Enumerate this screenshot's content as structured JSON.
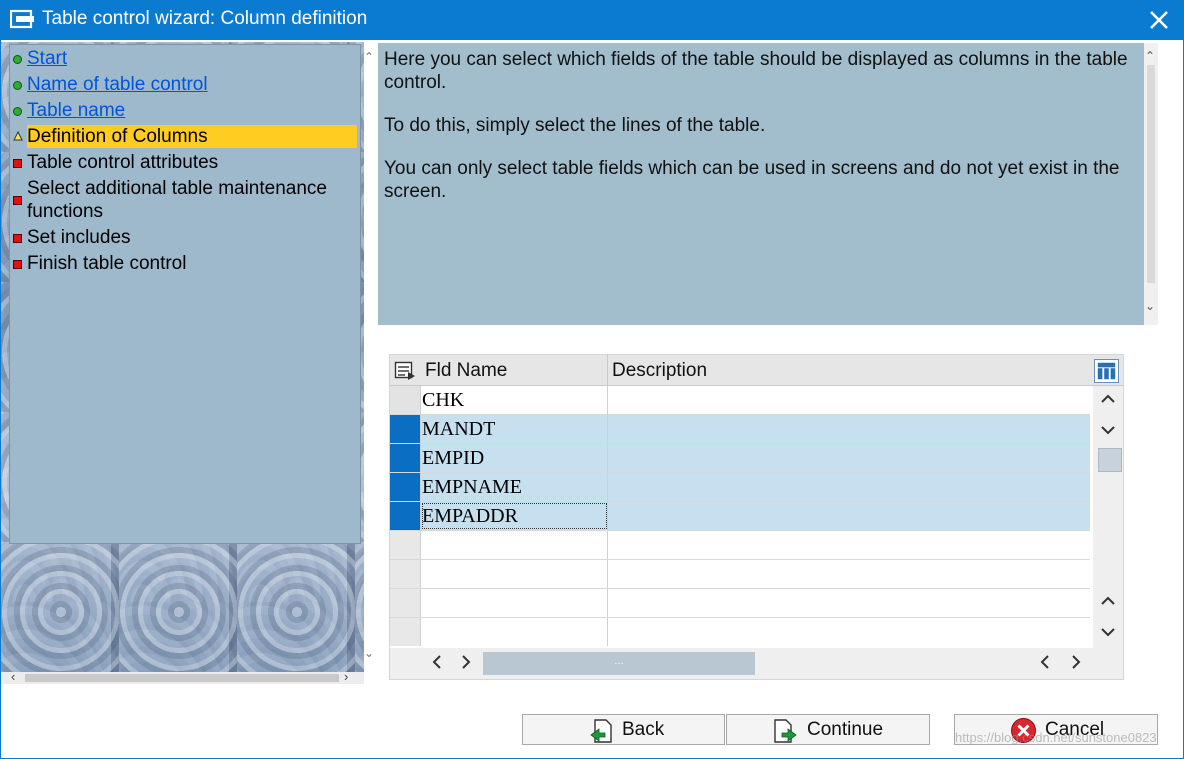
{
  "window": {
    "title": "Table control wizard: Column definition",
    "titlebar_color": "#0a7bd1"
  },
  "nav": {
    "items": [
      {
        "label": "Start",
        "state": "done",
        "link": true
      },
      {
        "label": "Name of table control",
        "state": "done",
        "link": true
      },
      {
        "label": "Table name",
        "state": "done",
        "link": true
      },
      {
        "label": "Definition of Columns",
        "state": "current",
        "link": false
      },
      {
        "label": "Table control attributes",
        "state": "pending",
        "link": false
      },
      {
        "label": "Select additional table maintenance functions",
        "state": "pending",
        "link": false
      },
      {
        "label": "Set includes",
        "state": "pending",
        "link": false
      },
      {
        "label": "Finish table control",
        "state": "pending",
        "link": false
      }
    ]
  },
  "info": {
    "paragraphs": [
      "Here you can select which fields of the table should be displayed as columns in the table control.",
      "To do this, simply select the lines of the table.",
      "You can only select table fields which can be used in screens and do not yet exist in the screen."
    ]
  },
  "table": {
    "columns": [
      "Fld Name",
      "Description"
    ],
    "rows": [
      {
        "field": "CHK",
        "description": "",
        "selected": false
      },
      {
        "field": "MANDT",
        "description": "",
        "selected": true
      },
      {
        "field": "EMPID",
        "description": "",
        "selected": true
      },
      {
        "field": "EMPNAME",
        "description": "",
        "selected": true
      },
      {
        "field": "EMPADDR",
        "description": "",
        "selected": true
      }
    ],
    "empty_rows": 4,
    "hscroll_thumb_label": "…"
  },
  "buttons": {
    "back": "Back",
    "continue": "Continue",
    "cancel": "Cancel"
  },
  "watermark": "https://blog.csdn.net/sunstone0823",
  "colors": {
    "current_step": "#ffcc22",
    "selected_row": "#c6e0f0",
    "selection_marker": "#0a6fc2",
    "info_panel": "#a2bdcc"
  }
}
